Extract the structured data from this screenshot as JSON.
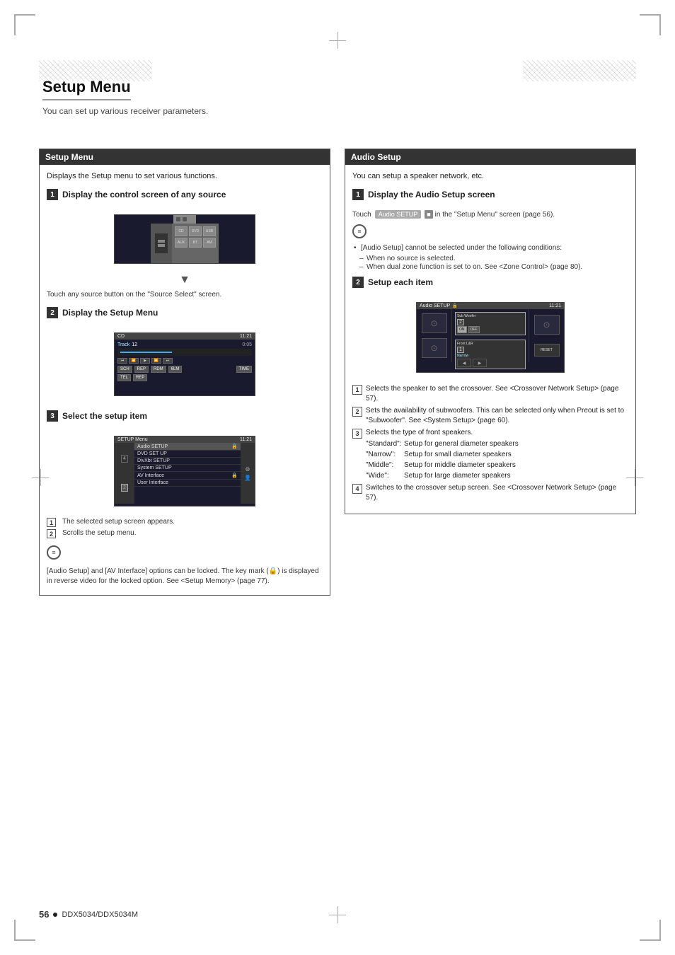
{
  "page": {
    "title": "Setup Menu",
    "subtitle": "You can set up various receiver parameters.",
    "footer": {
      "page_number": "56",
      "bullet": "●",
      "model": "DDX5034/DDX5034M"
    }
  },
  "left_section": {
    "header": "Setup Menu",
    "intro": "Displays the Setup menu to set various functions.",
    "step1": {
      "label": "Display the control screen of any source",
      "step_number": "1"
    },
    "step1_instruction": "Touch any source button on the \"Source Select\" screen.",
    "step2": {
      "label": "Display the Setup Menu",
      "step_number": "2"
    },
    "step3": {
      "label": "Select the setup item",
      "step_number": "3"
    },
    "cd_screen": {
      "label": "CD",
      "time": "11:21",
      "track": "Track",
      "track_num": "12",
      "time_val": "0:05"
    },
    "setup_screen": {
      "label": "SETUP Menu",
      "time": "11:21",
      "items": [
        {
          "name": "Audio SETUP",
          "has_icon": true
        },
        {
          "name": "DVD SET UP",
          "has_icon": false
        },
        {
          "name": "DivXbt SETUP",
          "has_icon": false
        },
        {
          "name": "System SETUP",
          "has_icon": false
        },
        {
          "name": "AV Interface",
          "has_icon": true
        },
        {
          "name": "User Interface",
          "has_icon": false
        }
      ]
    },
    "selected_note": "The selected setup screen appears.",
    "scrolls_note": "Scrolls the setup menu.",
    "lock_note": "[Audio Setup] and [AV Interface] options can be locked. The key mark (🔒) is displayed in reverse video for the locked option. See <Setup Memory> (page 77).",
    "note_badge1": "1",
    "note_badge2": "2"
  },
  "right_section": {
    "header": "Audio Setup",
    "intro": "You can setup a speaker network, etc.",
    "step1": {
      "label": "Display the Audio Setup screen",
      "step_number": "1"
    },
    "touch_text": "Touch",
    "chip_label": "Audio SETUP",
    "in_text": "in the \"Setup Menu\" screen (page 56).",
    "notes": {
      "intro": "[Audio Setup] cannot be selected under the following conditions:",
      "items": [
        "When no source is selected.",
        "When dual zone function is set to on. See <Zone Control> (page 80)."
      ]
    },
    "step2": {
      "label": "Setup each item",
      "step_number": "2"
    },
    "audio_screen": {
      "label": "Audio SETUP",
      "time": "11:21",
      "sub_woofer_label": "Sub Woofer",
      "on": "ON",
      "off": "OFF",
      "front_lr": "Front L&R",
      "narrow": "Narrow",
      "reset_btn": "RESET"
    },
    "numbered_items": [
      {
        "num": "1",
        "text": "Selects the speaker to set the crossover. See <Crossover Network Setup> (page 57)."
      },
      {
        "num": "2",
        "text": "Sets the availability of subwoofers. This can be selected only when Preout is set to \"Subwoofer\". See <System Setup> (page 60)."
      },
      {
        "num": "3",
        "text": "Selects the type of front speakers.\n\"Standard\": Setup for general diameter speakers\n\"Narrow\": Setup for small diameter speakers\n\"Middle\": Setup for middle diameter speakers\n\"Wide\": Setup for large diameter speakers"
      },
      {
        "num": "4",
        "text": "Switches to the crossover setup screen. See <Crossover Network Setup> (page 57)."
      }
    ],
    "standard_label": "\"Standard\":",
    "standard_desc": "Setup for general diameter speakers",
    "narrow_label": "\"Narrow\":",
    "narrow_desc": "Setup for small diameter speakers",
    "middle_label": "\"Middle\":",
    "middle_desc": "Setup for middle diameter speakers",
    "wide_label": "\"Wide\":",
    "wide_desc": "Setup for large diameter speakers"
  }
}
